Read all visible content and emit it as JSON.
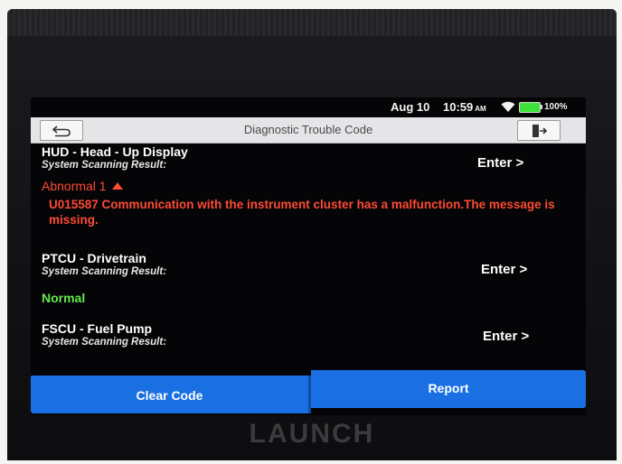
{
  "status_bar": {
    "date": "Aug 10",
    "time": "10:59",
    "ampm": "AM",
    "battery": "100%",
    "icons": [
      "wifi-icon",
      "battery-icon"
    ]
  },
  "header": {
    "title": "Diagnostic Trouble Code",
    "back_icon": "back-arrow-icon",
    "exit_icon": "exit-icon"
  },
  "systems": [
    {
      "name": "HUD - Head - Up Display",
      "result_label": "System Scanning Result:",
      "status": "Abnormal 1",
      "dtc": "U015587 Communication with the instrument cluster has a malfunction.The message is missing.",
      "enter_label": "Enter >"
    },
    {
      "name": "PTCU - Drivetrain",
      "result_label": "System Scanning Result:",
      "status": "Normal",
      "enter_label": "Enter >"
    },
    {
      "name": "FSCU - Fuel Pump",
      "result_label": "System Scanning Result:",
      "enter_label": "Enter >"
    }
  ],
  "buttons": {
    "clear": "Clear Code",
    "report": "Report"
  },
  "device": {
    "brand": "LAUNCH"
  },
  "colors": {
    "accent": "#1a6fe2",
    "abnormal": "#ff4a33",
    "normal": "#64e84c"
  }
}
